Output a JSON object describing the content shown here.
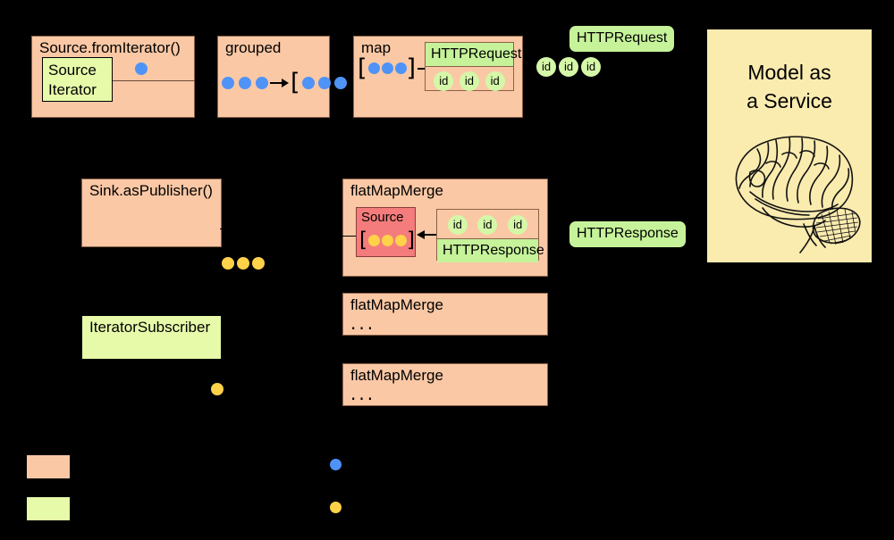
{
  "diagram": {
    "title": "Akka Streams HTTP pipeline diagram",
    "colors": {
      "stage_fill": "#FAC8A5",
      "domain_fill": "#E6FAAA",
      "badge_fill": "#C6F29A",
      "source_fill": "#F47C7C",
      "model_fill": "#FAEBAF",
      "element_dot": "#4F93F7",
      "response_dot": "#FFD24A",
      "background": "#000000"
    }
  },
  "stages": {
    "source_from_iterator": {
      "label": "Source.fromIterator()",
      "inner_label_line1": "Source",
      "inner_label_line2": "Iterator"
    },
    "grouped": {
      "label": "grouped",
      "input_dots": 3,
      "output_dots": 3,
      "open_bracket": "[",
      "close_bracket": "]"
    },
    "map": {
      "label": "map",
      "input_dots": 3,
      "open_bracket": "[",
      "close_bracket": "]",
      "request_header": "HTTPRequest",
      "request_ids": [
        "id",
        "id",
        "id"
      ]
    },
    "sink_as_publisher": {
      "label": "Sink.asPublisher()"
    },
    "iterator_subscriber": {
      "label": "IteratorSubscriber"
    },
    "flat_map_merge_main": {
      "label": "flatMapMerge",
      "source_label": "Source",
      "source_dots": 3,
      "open_bracket": "[",
      "close_bracket": "]",
      "response_ids": [
        "id",
        "id",
        "id"
      ],
      "response_footer": "HTTPResponse"
    },
    "flat_map_merge_2": {
      "label": "flatMapMerge",
      "ellipsis": "..."
    },
    "flat_map_merge_3": {
      "label": "flatMapMerge",
      "ellipsis": "..."
    }
  },
  "badges": {
    "http_request": "HTTPRequest",
    "http_response": "HTTPResponse",
    "request_ids": [
      "id",
      "id",
      "id"
    ]
  },
  "model_panel": {
    "title_line1": "Model as",
    "title_line2": "a Service",
    "illustration": "brain-illustration"
  },
  "loose_dots": {
    "publisher_dots": 3,
    "subscriber_dots": 1
  },
  "legend": {
    "items": [
      {
        "swatch_color": "#FAC8A5",
        "label": ""
      },
      {
        "swatch_color": "#E6FAAA",
        "label": ""
      },
      {
        "dot_color": "#4F93F7",
        "label": ""
      },
      {
        "dot_color": "#FFD24A",
        "label": ""
      }
    ]
  }
}
